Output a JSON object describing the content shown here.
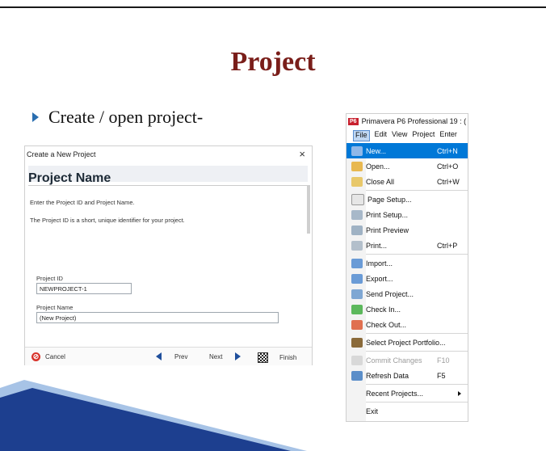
{
  "slide": {
    "title": "Project",
    "bullet": "Create / open project-"
  },
  "dialog": {
    "window_title": "Create a New Project",
    "close": "×",
    "heading": "Project Name",
    "line1": "Enter the Project ID and Project Name.",
    "line2": "The Project ID is a short, unique identifier for your project.",
    "id_label": "Project ID",
    "id_value": "NEWPROJECT-1",
    "name_label": "Project Name",
    "name_value": "(New Project)",
    "cancel": "Cancel",
    "prev": "Prev",
    "next": "Next",
    "finish": "Finish"
  },
  "p6": {
    "logo": "P6",
    "window_title": "Primavera P6 Professional 19 : (",
    "menubar": [
      "File",
      "Edit",
      "View",
      "Project",
      "Enter"
    ],
    "items": [
      {
        "label": "New...",
        "shortcut": "Ctrl+N",
        "selected": true
      },
      {
        "label": "Open...",
        "shortcut": "Ctrl+O"
      },
      {
        "label": "Close All",
        "shortcut": "Ctrl+W"
      },
      {
        "label": "Page Setup..."
      },
      {
        "label": "Print Setup..."
      },
      {
        "label": "Print Preview"
      },
      {
        "label": "Print...",
        "shortcut": "Ctrl+P"
      },
      {
        "label": "Import..."
      },
      {
        "label": "Export..."
      },
      {
        "label": "Send Project..."
      },
      {
        "label": "Check In..."
      },
      {
        "label": "Check Out..."
      },
      {
        "label": "Select Project Portfolio..."
      },
      {
        "label": "Commit Changes",
        "shortcut": "F10",
        "disabled": true
      },
      {
        "label": "Refresh Data",
        "shortcut": "F5"
      },
      {
        "label": "Recent Projects..."
      },
      {
        "label": "Exit"
      }
    ]
  },
  "colors": {
    "title": "#7a1e1a",
    "bullet_marker": "#2a6eb0",
    "menu_selection": "#0078d7",
    "deco_dark": "#1d3f8f",
    "deco_light": "#a7c3e6"
  }
}
